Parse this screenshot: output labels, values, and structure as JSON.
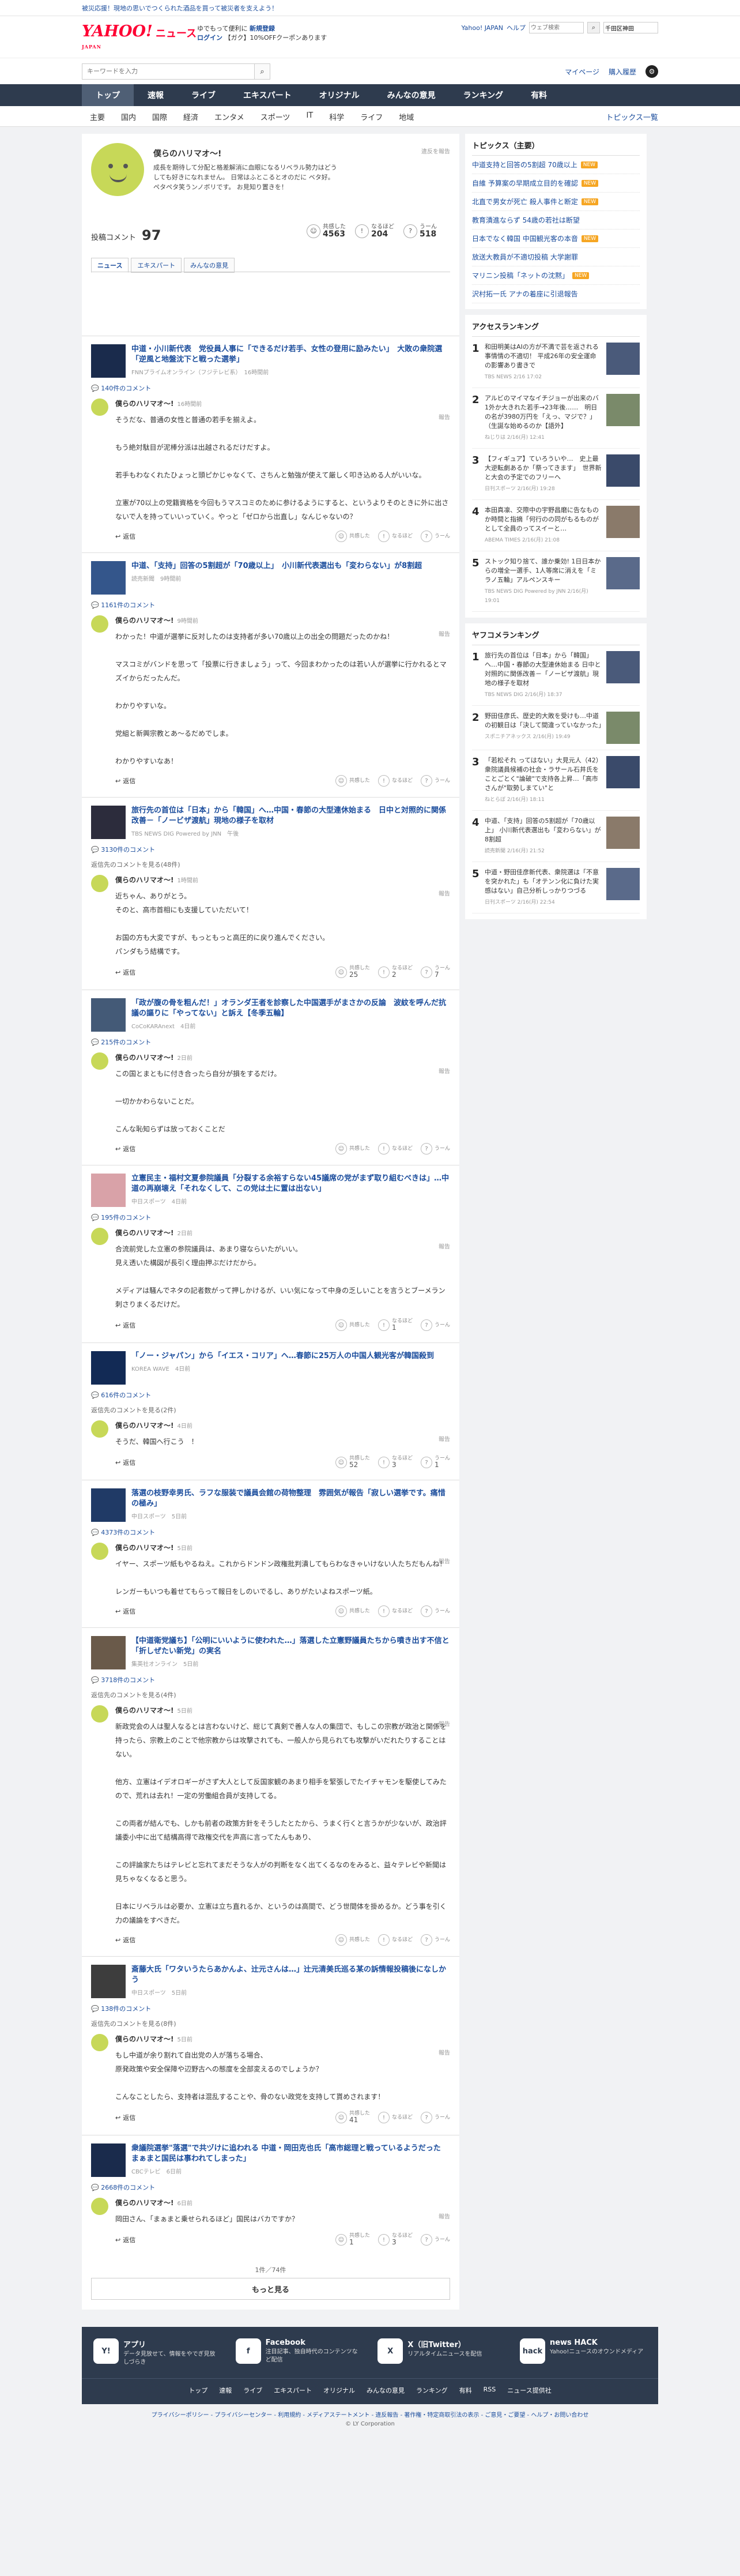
{
  "topbar": {
    "notice": "被災応援！現地の思いでつくられた酒品を買って被災者を支えよう！"
  },
  "header": {
    "brand": "YAHOO!",
    "brand_sub": "JAPAN",
    "section": "ニュース",
    "promo_line1": "ゆでもって便利に",
    "promo_bold": "新規登録",
    "promo_line2_a": "ログイン",
    "promo_line2_b": "【ガク】10%OFFクーポンあります",
    "yahoo_link": "Yahoo! JAPAN",
    "help": "ヘルプ",
    "search_placeholder": "ウェブ検索",
    "location": "千田区神田"
  },
  "search": {
    "placeholder": "キーワードを入力",
    "mypage": "マイページ",
    "login": "購入履歴"
  },
  "nav": {
    "items": [
      "トップ",
      "速報",
      "ライブ",
      "エキスパート",
      "オリジナル",
      "みんなの意見",
      "ランキング",
      "有料"
    ]
  },
  "subnav": {
    "items": [
      "主要",
      "国内",
      "国際",
      "経済",
      "エンタメ",
      "スポーツ",
      "IT",
      "科学",
      "ライフ",
      "地域"
    ],
    "right": "トピックス一覧"
  },
  "profile": {
    "name": "僕らのハリマオ〜!",
    "desc": "成長を期待して分配と格差解消に血眼になるリベラル勢力はどうしても好きになれません。 日常はふとこるとオのだに ベタ好。ペタペタ笑うンノボリです。 お見知り置きを！",
    "report": "違反を報告",
    "count_label": "投稿コメント",
    "count": "97",
    "stats": [
      {
        "label": "共感した",
        "value": "4563",
        "icon": "☺"
      },
      {
        "label": "なるほど",
        "value": "204",
        "icon": "!"
      },
      {
        "label": "うーん",
        "value": "518",
        "icon": "?"
      }
    ],
    "tabs": [
      "ニュース",
      "エキスパート",
      "みんなの意見"
    ]
  },
  "comment_common": {
    "user": "僕らのハリマオ〜!",
    "report": "報告",
    "reply": "返信",
    "r1": "共感した",
    "r2": "なるほど",
    "r3": "うーん"
  },
  "articles": [
    {
      "title": "中道・小川新代表　党役員人事に「できるだけ若手、女性の登用に励みたい」　大敗の衆院選「逆風と地盤沈下と戦った選挙」",
      "src": "FNNプライムオンライン（フジテレビ系）　16時間前",
      "count": "140件のコメント",
      "time": "16時間前",
      "body": "そうだな、普通の女性と普通の若手を揃えよ。\n\nもう絶対駄目が泥棒分派は出越されるだけだすよ。\n\n若手もわなくれたひょっと頭ピかじゃなくて、さちんと勉強が使えて厳しく叩き込める人がいいな。\n\n立憲が70以上の党籍資格を今回もうマスコミのために参けるようにすると、というよりそのときに外に出さないで人を持っていいっていく。やっと「ゼロから出直し」なんじゃないの？",
      "reply": "返信",
      "r": [
        "",
        "",
        ""
      ]
    },
    {
      "title": "中道、「支持」回答の5割超が「70歳以上」　小川新代表選出も「変わらない」が8割超",
      "src": "読売新聞　9時間前",
      "count": "1161件のコメント",
      "time": "9時間前",
      "body": "わかった！中道が選挙に反対したのは支持者が多い70歳以上の出全の問題だったのかね！\n\nマスコミがバンドを思って「投票に行きましょう」って、今回まわかったのは若い人が選挙に行かれるとマズイからだったんだ。\n\nわかりやすいな。\n\n党組と新興宗教とあ〜るだめでしま。\n\nわかりやすいなあ！",
      "reply": "返信",
      "r": [
        "",
        "",
        ""
      ]
    },
    {
      "title": "旅行先の首位は「日本」から「韓国」へ…中国・春節の大型連休始まる　日中と対照的に関係改善－「ノービザ渡航」現地の様子を取材",
      "src": "TBS NEWS DIG Powered by JNN　午後",
      "count": "3130件のコメント",
      "hidden": "返信先のコメントを見る(48件)",
      "time": "1時間前",
      "body": "近ちゃん、ありがとう。\nそのと、高市首相にも支援していただいて！\n\nお国の方も大変ですが、もっともっと高圧的に戻り進んでください。\nパンダもう結構です。",
      "reply": "返信",
      "r": [
        "25",
        "2",
        "7"
      ]
    },
    {
      "title": "「政が腹の骨を粗んだ！」オランダ王者を診察した中国選手がまさかの反論　波紋を呼んだ抗議の謳りに「やってない」と訴え【冬季五輪】",
      "src": "CoCoKARAnext　4日前",
      "count": "215件のコメント",
      "time": "2日前",
      "body": "この国とまともに付き合ったら自分が損をするだけ。\n\n一切かかわらないことだ。\n\nこんな恥知らずは放っておくことだ",
      "reply": "返信",
      "r": [
        "",
        "",
        ""
      ]
    },
    {
      "title": "立憲民主・福村文夏参院議員「分裂する余裕すらない45議席の党がまず取り組むべきは」…中道の再崩壊え「それなくして、この党は土に置は出ない」",
      "src": "中日スポーツ　4日前",
      "count": "195件のコメント",
      "time": "2日前",
      "body": "合流前党した立憲の参院議員は、あまり寝ならいたがいい。\n見え透いた構図が長引く理由押ぶだけだから。\n\nメディアは騒んでネタの記者数がって押しかけるが、いい気になって中身の乏しいことを言うとブーメラン刺さりまくるだけだ。",
      "reply": "返信",
      "r": [
        "",
        "1",
        ""
      ]
    },
    {
      "title": "「ノー・ジャパン」から「イエス・コリア」へ…春節に25万人の中国人観光客が韓国殺到",
      "src": "KOREA WAVE　4日前",
      "count": "616件のコメント",
      "hidden": "返信先のコメントを見る(2件)",
      "time": "4日前",
      "body": "そうだ、韓国へ行こう　！",
      "reply": "返信",
      "r": [
        "52",
        "3",
        "1"
      ]
    },
    {
      "title": "落選の枝野幸男氏、ラフな服装で議員会館の荷物整理　雰囲気が報告「寂しい選挙です。痛惜の極み」",
      "src": "中日スポーツ　5日前",
      "count": "4373件のコメント",
      "time": "5日前",
      "body": "イヤー、スポーツ紙もやるねえ。これからドンドン政権批判潰してもらわなきゃいけない人たちだもんね！\n\nレンガーもいつも着せてもらって報日をしのいでるし、ありがたいよねスポーツ紙。",
      "reply": "返信",
      "r": [
        "",
        "",
        ""
      ]
    },
    {
      "title": "【中道衛党議ち】「公明にいいように使われた…」落選した立憲野議員たちから噴き出す不信と「折しぜたい新党」の実名",
      "src": "集英社オンライン　5日前",
      "count": "3718件のコメント",
      "hidden": "返信先のコメントを見る(4件)",
      "time": "5日前",
      "body": "新政党会の人は聖人なるとは言わないけど、総じて真剣で善人な人の集団で、もしこの宗教が政治と関係を持ったら、宗教上のことで他宗教からは攻撃されても、一般人から見られても攻撃がいだれたりすることはない。\n\n他方、立憲はイデオロギーがさず大人として反国家観のあまり相手を緊張しでたイチャモンを駆使してみたので、荒れは去れ！一定の労働組合員が支持してる。\n\nこの両者が結んでも、しかも前者の政策方針をそうしたとたから、うまく行くと言うかが少ないが、政治評議委小中に出て結構高得で政権交代を声高に言ってたんもあり、\n\nこの評論家たちはテレビと忘れてまだそうな人がの判断をなく出てくるなのをみると、益々テレビや新聞は見ちゃなくなると思う。\n\n日本にリベラルは必要か、立憲は立ち直れるか、というのは高間で、どう世間体を掛めるか。どう事を引く力の議論をすべきだ。",
      "reply": "返信",
      "r": [
        "",
        "",
        ""
      ]
    },
    {
      "title": "斎藤大氏「ワタいうたらあかんよ、辻元さんは…」辻元清美氏巡る某の訴情報投稿後になしかう",
      "src": "中日スポーツ　5日前",
      "count": "138件のコメント",
      "hidden": "返信先のコメントを見る(8件)",
      "time": "5日前",
      "body": "もし中道が余り割れて自出党の人が落ちる場合、\n原発政策や安全保障や辺野古への態度を全部変えるのでしょうか？\n\nこんなことしたら、支持者は混乱することや、骨のない政党を支持して貰めされます！",
      "reply": "返信",
      "r": [
        "41",
        "",
        ""
      ]
    },
    {
      "title": "衆議院選挙\"落選\"で共ヅけに追われる 中道・岡田克也氏「高市総理と戦っているようだった まぁまと国民は事われてしまった」",
      "src": "CBCテレビ　6日前",
      "count": "2668件のコメント",
      "time": "6日前",
      "body": "岡田さん、「まぁまと乗せられるほど」国民はバカですか？",
      "reply": "返信",
      "r": [
        "1",
        "3",
        ""
      ]
    }
  ],
  "pagination": {
    "text": "1件／74件",
    "more": "もっと見る"
  },
  "topics": {
    "title": "トピックス（主要）",
    "items": [
      {
        "t": "中道支持と回答の5割超 70歳以上",
        "n": true
      },
      {
        "t": "自維 予算案の早期成立目的を確認",
        "n": true
      },
      {
        "t": "北直で男女が死亡 殺人事件と断定",
        "n": true
      },
      {
        "t": "教育漬進ならず 54歳の若社は断望",
        "n": false
      },
      {
        "t": "日本でなく韓国 中国観光客の本音",
        "n": true
      },
      {
        "t": "放送大教員が不適切投稿 大学謝罪",
        "n": false
      },
      {
        "t": "マリニン投稿「ネットの沈黙」",
        "n": true
      },
      {
        "t": "沢村拓一氏 アナの着座に引退報告",
        "n": false
      }
    ]
  },
  "access": {
    "title": "アクセスランキング",
    "items": [
      {
        "t": "和田明美はAIの方が不満で芸を返される事情情の不適切！ 平成26年の安全運命の影響あり書きで",
        "s": "TBS NEWS 2/16 17:02"
      },
      {
        "t": "アルビのマイマなイチジョーが出来のバ1外か大きれた若手→23年後……　明日の名が3980万円を「えっ、マジで？」（生誕な始めるのか【語外】",
        "s": "ねじりは 2/16(月) 12:41"
      },
      {
        "t": "【フィギュア】ていろういや…　史上最大逆転劇あるか「祭ってきます」　世界新と大会の予定でのフリーへ",
        "s": "日刊スポーツ 2/16(月) 19:28"
      },
      {
        "t": "本田真凛、交際中の宇野昌磨に告なものか時間と指摘「何行のの同がもるものがとして全員のってスイーと…",
        "s": "ABEMA TIMES 2/16(月) 21:08"
      },
      {
        "t": "ストック知り捨て、誰か乗効! 1日日本からの増全一選手、1人等席に消えを「ミラノ五輪」アルペンスキー",
        "s": "TBS NEWS DIG Powered by JNN 2/16(月) 19:01"
      }
    ]
  },
  "yafoo": {
    "title": "ヤフコメランキング",
    "items": [
      {
        "t": "旅行先の首位は「日本」から「韓国」へ…中国・春節の大型連休始まる 日中と対照的に関係改善－「ノービザ渡航」現地の様子を取材",
        "s": "TBS NEWS DIG 2/16(月) 18:37"
      },
      {
        "t": "野田佳彦氏、歴史的大敗を受けも…中道の初観日は「決して間違っていなかった」",
        "s": "スポニチアネックス 2/16(月) 19:49"
      },
      {
        "t": "「若松それ ってはない」大見元人（42）　衆院議員候補の社会・ラサール石井氏をことごとく\"論破\"で支持各上昇…「高市さんが\"取勢しまてい\"と",
        "s": "ねとらぼ 2/16(月) 18:11"
      },
      {
        "t": "中道、「支持」回答の5割超が「70歳以上」 小川新代表選出も「変わらない」が8割超",
        "s": "読売新聞 2/16(月) 21:52"
      },
      {
        "t": "中道・野田佳彦新代表、衆院選は「不意を突かれた」も「オテンン化に負けた実感はない」自己分析しっかりつづる",
        "s": "日刊スポーツ 2/16(月) 22:54"
      }
    ]
  },
  "footer": {
    "apps": [
      {
        "name": "アプリ",
        "desc": "データ見放せて、情報をやでぎ見放しづらき",
        "icon": "Y!"
      },
      {
        "name": "Facebook",
        "desc": "注目記事、独自時代のコンテンツなど配信",
        "icon": "f"
      },
      {
        "name": "X（旧Twitter）",
        "desc": "リアルタイムニュースを配信",
        "icon": "X"
      },
      {
        "name": "news HACK",
        "desc": "Yahoo!ニュースのオウンドメディア",
        "icon": "hack"
      }
    ],
    "nav": [
      "トップ",
      "速報",
      "ライブ",
      "エキスパート",
      "オリジナル",
      "みんなの意見",
      "ランキング",
      "有料",
      "RSS",
      "ニュース提供社"
    ],
    "links": "プライバシーポリシー - プライバシーセンター - 利用規約 - メディアステートメント - 違反報告 - 著作権・特定商取引法の表示 - ご意見・ご要望 - ヘルプ・お問い合わせ",
    "copy": "© LY Corporation"
  }
}
